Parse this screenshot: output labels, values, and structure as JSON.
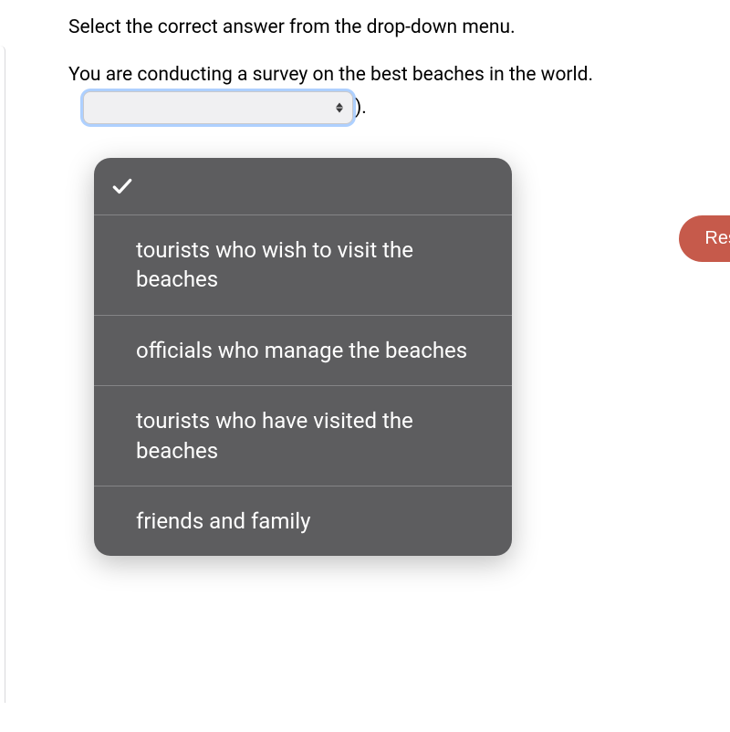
{
  "instruction": "Select the correct answer from the drop-down menu.",
  "question": "You are conducting a survey on the best beaches in the world. ",
  "close_punct": ").",
  "dropdown": {
    "selected": "",
    "options": [
      "",
      "tourists who wish to visit the beaches",
      "officials who manage the beaches",
      "tourists who have visited the beaches",
      "friends and family"
    ]
  },
  "buttons": {
    "reset": "Res"
  }
}
